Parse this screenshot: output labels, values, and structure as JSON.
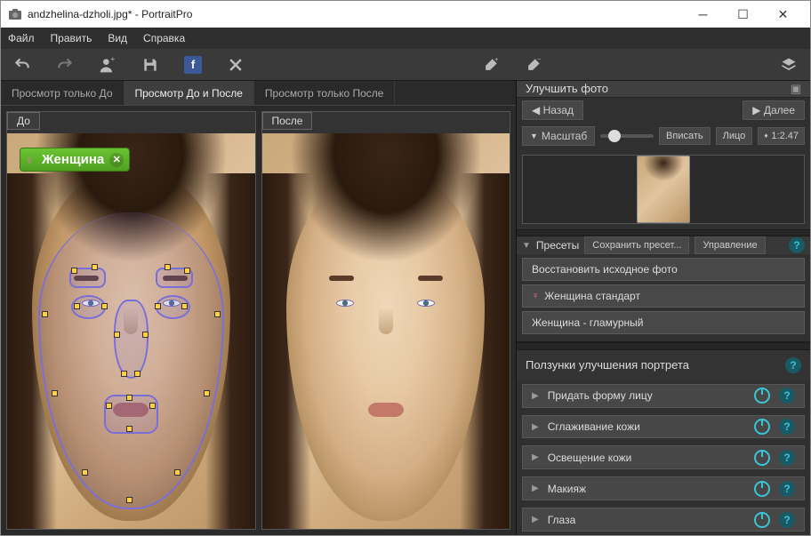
{
  "titlebar": {
    "title": "andzhelina-dzholi.jpg* - PortraitPro"
  },
  "menubar": {
    "file": "Файл",
    "edit": "Править",
    "view": "Вид",
    "help": "Справка"
  },
  "tabs": {
    "before_only": "Просмотр только До",
    "before_after": "Просмотр До и После",
    "after_only": "Просмотр только После"
  },
  "labels": {
    "before": "До",
    "after": "После"
  },
  "gender": {
    "text": "Женщина"
  },
  "right": {
    "header": "Улучшить фото",
    "nav": {
      "back": "Назад",
      "next": "Далее"
    },
    "zoom": {
      "label": "Масштаб",
      "fit": "Вписать",
      "face": "Лицо",
      "ratio": "1:2.47"
    },
    "presets": {
      "label": "Пресеты",
      "save": "Сохранить пресет...",
      "manage": "Управление",
      "restore": "Восстановить исходное фото",
      "std": "Женщина стандарт",
      "glam": "Женщина - гламурный"
    },
    "sliders_title": "Ползунки улучшения портрета",
    "sliders": {
      "face_shape": "Придать форму лицу",
      "skin_smooth": "Сглаживание кожи",
      "skin_light": "Освещение кожи",
      "makeup": "Макияж",
      "eyes": "Глаза"
    }
  }
}
